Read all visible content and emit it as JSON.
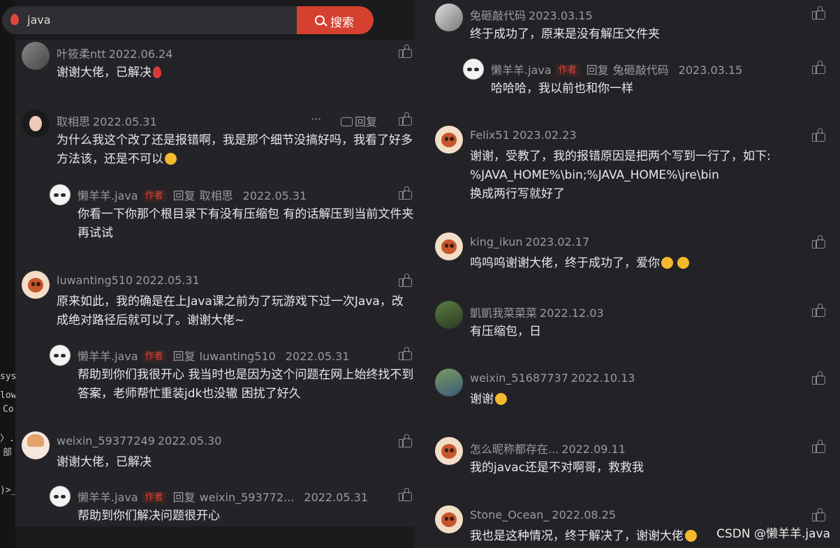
{
  "search": {
    "query": "java",
    "button": "搜索"
  },
  "terminal": {
    "lines": [
      "sys",
      "low",
      "Co",
      "〉.j",
      "部",
      ")>_"
    ]
  },
  "like_icon": "thumbs-up-icon",
  "left_comments": [
    {
      "name": "叶筱柔ntt",
      "date": "2022.06.24",
      "text": "谢谢大佬，已解决",
      "emoji": "rose"
    },
    {
      "name": "取相思",
      "date": "2022.05.31",
      "more": "···",
      "reply": "回复",
      "text": "为什么我这个改了还是报错啊，我是那个细节没搞好吗，我看了好多方法该，还是不可以"
    },
    {
      "name": "懒羊羊.java",
      "tag": "作者",
      "reply_word": "回复",
      "target": "取相思",
      "date": "2022.05.31",
      "text": "你看一下你那个根目录下有没有压缩包 有的话解压到当前文件夹再试试"
    },
    {
      "name": "luwanting510",
      "date": "2022.05.31",
      "text": "原来如此，我的确是在上Java课之前为了玩游戏下过一次Java，改成绝对路径后就可以了。谢谢大佬~"
    },
    {
      "name": "懒羊羊.java",
      "tag": "作者",
      "reply_word": "回复",
      "target": "luwanting510",
      "date": "2022.05.31",
      "text": "帮助到你们我很开心 我当时也是因为这个问题在网上始终找不到答案，老师帮忙重装jdk也没辙 困扰了好久"
    },
    {
      "name": "weixin_59377249",
      "date": "2022.05.30",
      "text": "谢谢大佬，已解决"
    },
    {
      "name": "懒羊羊.java",
      "tag": "作者",
      "reply_word": "回复",
      "target": "weixin_593772...",
      "date": "2022.05.31",
      "text": "帮助到你们解决问题很开心"
    }
  ],
  "right_comments": [
    {
      "name": "兔砸敲代码",
      "date": "2023.03.15",
      "text": "终于成功了，原来是没有解压文件夹"
    },
    {
      "name": "懒羊羊.java",
      "tag": "作者",
      "reply_word": "回复",
      "target": "兔砸敲代码",
      "date": "2023.03.15",
      "text": "哈哈哈，我以前也和你一样"
    },
    {
      "name": "Felix51",
      "date": "2023.02.23",
      "text": "谢谢，受教了，我的报错原因是把两个写到一行了，如下:%JAVA_HOME%\\bin;%JAVA_HOME%\\jre\\bin换成两行写就好了",
      "lines": [
        "谢谢，受教了，我的报错原因是把两个写到一行了，如下:",
        "%JAVA_HOME%\\bin;%JAVA_HOME%\\jre\\bin",
        "换成两行写就好了"
      ]
    },
    {
      "name": "king_ikun",
      "date": "2023.02.17",
      "text": "呜呜呜谢谢大佬，终于成功了，爱你"
    },
    {
      "name": "凱凱我菜菜菜",
      "date": "2022.12.03",
      "text": "有压缩包，日"
    },
    {
      "name": "weixin_51687737",
      "date": "2022.10.13",
      "text": "谢谢"
    },
    {
      "name": "怎么昵称都存在...",
      "date": "2022.09.11",
      "text": "我的javac还是不对啊哥，救救我"
    },
    {
      "name": "Stone_Ocean_",
      "date": "2022.08.25",
      "text": "我也是这种情况，终于解决了，谢谢大佬"
    }
  ],
  "watermark": "CSDN @懒羊羊.java",
  "colors": {
    "accent": "#d6402f",
    "tag_text": "#e0463b",
    "panel": "#242428",
    "muted": "#9a9aa0"
  }
}
